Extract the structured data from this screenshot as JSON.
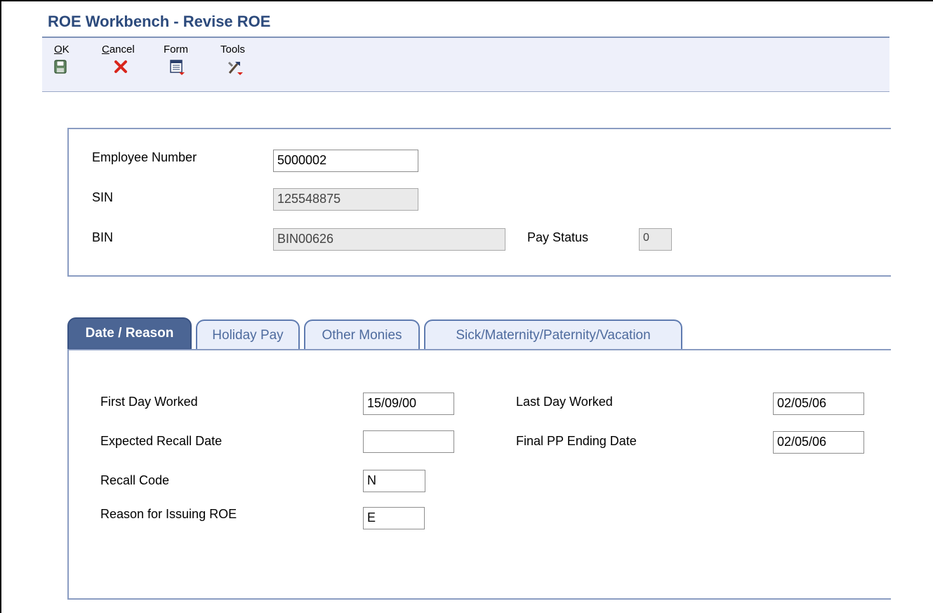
{
  "window": {
    "title": "ROE Workbench - Revise ROE"
  },
  "toolbar": {
    "ok": {
      "label_hotkey": "O",
      "label_rest": "K",
      "icon": "save-icon"
    },
    "cancel": {
      "label_hotkey": "C",
      "label_rest": "ancel",
      "icon": "close-icon"
    },
    "form": {
      "label": "Form",
      "icon": "form-menu-icon"
    },
    "tools": {
      "label": "Tools",
      "icon": "tools-menu-icon"
    }
  },
  "header": {
    "employee_number": {
      "label": "Employee Number",
      "value": "5000002"
    },
    "sin": {
      "label": "SIN",
      "value": "125548875"
    },
    "bin": {
      "label": "BIN",
      "value": "BIN00626"
    },
    "pay_status": {
      "label": "Pay Status",
      "value": "0"
    }
  },
  "tabs": [
    {
      "label": "Date / Reason",
      "active": true
    },
    {
      "label": "Holiday Pay",
      "active": false
    },
    {
      "label": "Other Monies",
      "active": false
    },
    {
      "label": "Sick/Maternity/Paternity/Vacation",
      "active": false
    }
  ],
  "date_reason": {
    "first_day_worked": {
      "label": "First Day Worked",
      "value": "15/09/00"
    },
    "last_day_worked": {
      "label": "Last Day Worked",
      "value": "02/05/06"
    },
    "expected_recall_date": {
      "label": "Expected Recall Date",
      "value": ""
    },
    "final_pp_ending_date": {
      "label": "Final PP Ending Date",
      "value": "02/05/06"
    },
    "recall_code": {
      "label": "Recall Code",
      "value": "N"
    },
    "reason_for_issuing_roe": {
      "label": "Reason for Issuing ROE",
      "value": "E"
    }
  },
  "colors": {
    "title": "#2c4a7c",
    "toolbar_bg": "#eef0fa",
    "active_tab": "#4b6594",
    "inactive_tab_text": "#4e6b9e",
    "panel_border": "#8a9cc2"
  }
}
